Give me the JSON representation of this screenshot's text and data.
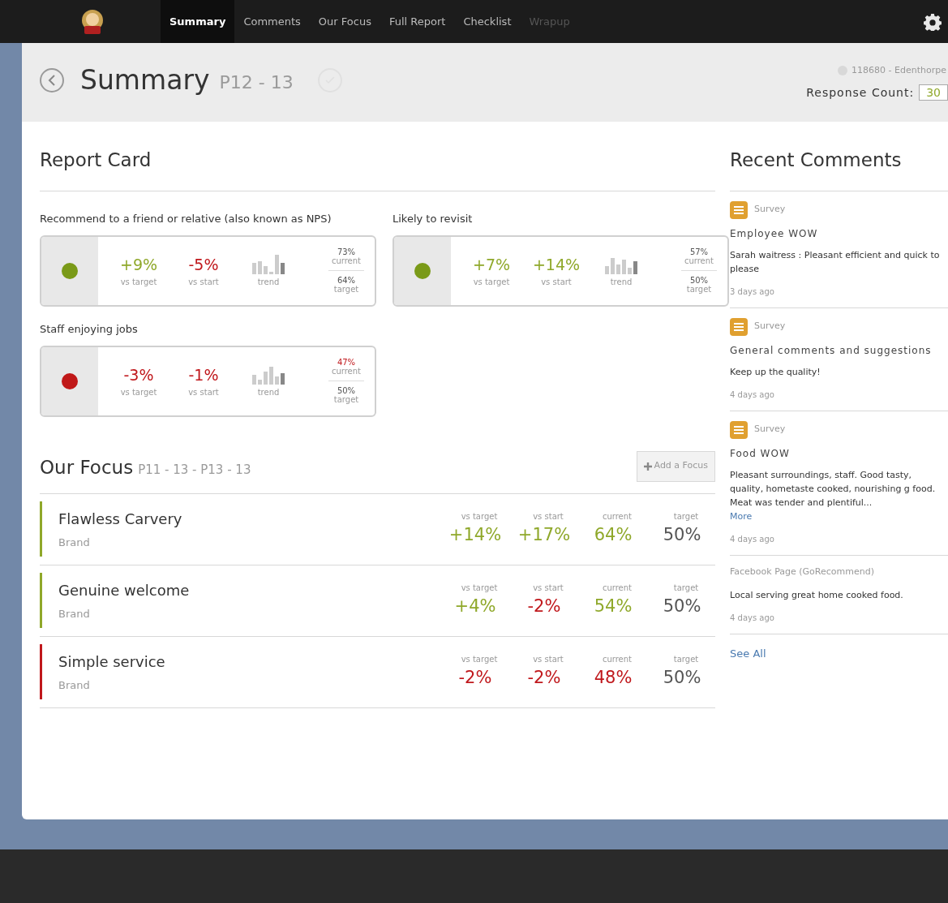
{
  "nav": {
    "tabs": [
      {
        "label": "Summary",
        "selected": true,
        "disabled": false
      },
      {
        "label": "Comments",
        "selected": false,
        "disabled": false
      },
      {
        "label": "Our Focus",
        "selected": false,
        "disabled": false
      },
      {
        "label": "Full Report",
        "selected": false,
        "disabled": false
      },
      {
        "label": "Checklist",
        "selected": false,
        "disabled": false
      },
      {
        "label": "Wrapup",
        "selected": false,
        "disabled": true
      }
    ]
  },
  "header": {
    "title": "Summary",
    "period": "P12 - 13",
    "site": "118680 - Edenthorpe",
    "response_label": "Response Count:",
    "response_count": "30"
  },
  "report_card": {
    "title": "Report Card",
    "cards": [
      {
        "label": "Recommend to a friend or relative (also known as NPS)",
        "color": "#7a9a18",
        "vs_target": {
          "value": "+9%",
          "label": "vs target",
          "color": "#8fa82a"
        },
        "vs_start": {
          "value": "-5%",
          "label": "vs start",
          "color": "#c0181c"
        },
        "trend_label": "trend",
        "current": {
          "value": "73%",
          "label": "current",
          "color": "#555555"
        },
        "target": {
          "value": "64%",
          "label": "target"
        }
      },
      {
        "label": "Likely to revisit",
        "color": "#7a9a18",
        "vs_target": {
          "value": "+7%",
          "label": "vs target",
          "color": "#8fa82a"
        },
        "vs_start": {
          "value": "+14%",
          "label": "vs start",
          "color": "#8fa82a"
        },
        "trend_label": "trend",
        "current": {
          "value": "57%",
          "label": "current",
          "color": "#555555"
        },
        "target": {
          "value": "50%",
          "label": "target"
        }
      },
      {
        "label": "Staff enjoying jobs",
        "color": "#c01818",
        "vs_target": {
          "value": "-3%",
          "label": "vs target",
          "color": "#c0181c"
        },
        "vs_start": {
          "value": "-1%",
          "label": "vs start",
          "color": "#c0181c"
        },
        "trend_label": "trend",
        "current": {
          "value": "47%",
          "label": "current",
          "color": "#c0181c"
        },
        "target": {
          "value": "50%",
          "label": "target"
        }
      }
    ]
  },
  "focus": {
    "title": "Our Focus",
    "period": "P11 - 13 - P13 - 13",
    "add_button": "Add a Focus",
    "rows": [
      {
        "name": "Flawless Carvery",
        "category": "Brand",
        "color": "#8fa82a",
        "metrics": [
          {
            "label": "vs target",
            "value": "+14%",
            "color": "#8fa82a"
          },
          {
            "label": "vs start",
            "value": "+17%",
            "color": "#8fa82a"
          },
          {
            "label": "current",
            "value": "64%",
            "color": "#8fa82a"
          },
          {
            "label": "target",
            "value": "50%",
            "color": "#555555"
          }
        ]
      },
      {
        "name": "Genuine welcome",
        "category": "Brand",
        "color": "#8fa82a",
        "metrics": [
          {
            "label": "vs target",
            "value": "+4%",
            "color": "#8fa82a"
          },
          {
            "label": "vs start",
            "value": "-2%",
            "color": "#c0181c"
          },
          {
            "label": "current",
            "value": "54%",
            "color": "#8fa82a"
          },
          {
            "label": "target",
            "value": "50%",
            "color": "#555555"
          }
        ]
      },
      {
        "name": "Simple service",
        "category": "Brand",
        "color": "#c0181c",
        "metrics": [
          {
            "label": "vs target",
            "value": "-2%",
            "color": "#c0181c"
          },
          {
            "label": "vs start",
            "value": "-2%",
            "color": "#c0181c"
          },
          {
            "label": "current",
            "value": "48%",
            "color": "#c0181c"
          },
          {
            "label": "target",
            "value": "50%",
            "color": "#555555"
          }
        ]
      }
    ]
  },
  "recent_comments": {
    "title": "Recent Comments",
    "items": [
      {
        "kind": "survey",
        "source": "Survey",
        "title": "Employee WOW",
        "text": "Sarah waitress : Pleasant efficient and quick to please",
        "time": "3 days ago"
      },
      {
        "kind": "survey",
        "source": "Survey",
        "title": "General comments and suggestions",
        "text": "Keep up the quality!",
        "time": "4 days ago"
      },
      {
        "kind": "survey",
        "source": "Survey",
        "title": "Food WOW",
        "text": "Pleasant surroundings, staff. Good tasty, quality, hometaste cooked, nourishing g food. Meat was tender and plentiful...",
        "more": "More",
        "time": "4 days ago"
      },
      {
        "kind": "social",
        "source": "Facebook Page (GoRecommend)",
        "text": "Local serving great home cooked food.",
        "time": "4 days ago"
      }
    ],
    "see_all": "See All"
  }
}
